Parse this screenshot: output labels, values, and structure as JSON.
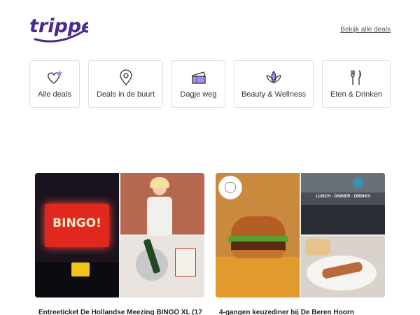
{
  "brand": {
    "logo_text": "tripper",
    "color": "#4b2a8f"
  },
  "header": {
    "all_deals_link": "Bekijk alle deals"
  },
  "categories": [
    {
      "label": "Alle deals",
      "icon": "heart-star-icon"
    },
    {
      "label": "Deals in de buurt",
      "icon": "location-pin-icon"
    },
    {
      "label": "Dagje weg",
      "icon": "ticket-icon"
    },
    {
      "label": "Beauty & Wellness",
      "icon": "lotus-icon"
    },
    {
      "label": "Eten & Drinken",
      "icon": "cutlery-icon"
    }
  ],
  "deals": [
    {
      "title": "Entreeticket De Hollandse Meezing BINGO XL (17",
      "image": "bingo-event-collage",
      "screen_text": "BINGO!"
    },
    {
      "title": "4-gangen keuzediner bij De Beren Hoorn",
      "image": "restaurant-food-collage",
      "sign_text": "LUNCH · DINNER · DRINKS"
    }
  ],
  "colors": {
    "icon_accent": "#a78bfa",
    "icon_stroke": "#333333",
    "border": "#e0e0e0"
  }
}
